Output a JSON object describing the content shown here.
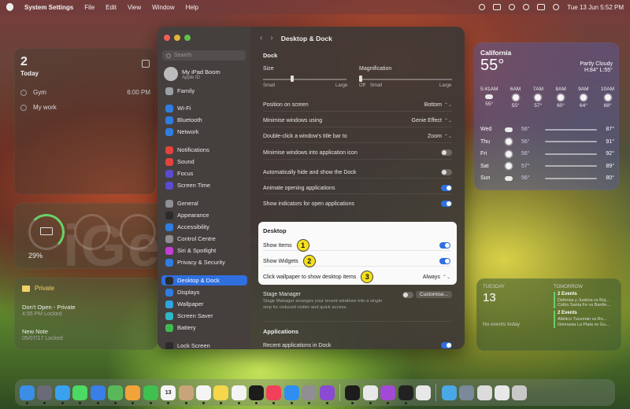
{
  "menubar": {
    "app_name": "System Settings",
    "menus": [
      "File",
      "Edit",
      "View",
      "Window",
      "Help"
    ],
    "clock": "Tue 13 Jun  5:52 PM"
  },
  "reminders_widget": {
    "count": "2",
    "label": "Today",
    "items": [
      {
        "title": "Gym",
        "time": "6:00 PM"
      },
      {
        "title": "My work",
        "time": ""
      }
    ]
  },
  "battery_widget": {
    "percent": "29%"
  },
  "notes_widget": {
    "folder": "Private",
    "notes": [
      {
        "title": "Don't Open - Private",
        "sub": "4:55 PM  Locked"
      },
      {
        "title": "New Note",
        "sub": "05/07/17  Locked"
      }
    ]
  },
  "weather_widget": {
    "city": "California",
    "temp": "55°",
    "condition": "Partly Cloudy",
    "hilo": "H:84° L:55°",
    "hours": [
      {
        "time": "5:41AM",
        "temp": "55°"
      },
      {
        "time": "6AM",
        "temp": "55°"
      },
      {
        "time": "7AM",
        "temp": "57°"
      },
      {
        "time": "8AM",
        "temp": "60°"
      },
      {
        "time": "9AM",
        "temp": "64°"
      },
      {
        "time": "10AM",
        "temp": "68°"
      }
    ],
    "days": [
      {
        "day": "Wed",
        "lo": "56°",
        "hi": "87°",
        "icon": "partly-cloudy-icon"
      },
      {
        "day": "Thu",
        "lo": "56°",
        "hi": "91°",
        "icon": "sun-icon"
      },
      {
        "day": "Fri",
        "lo": "56°",
        "hi": "92°",
        "icon": "sun-icon"
      },
      {
        "day": "Sat",
        "lo": "57°",
        "hi": "89°",
        "icon": "sun-icon"
      },
      {
        "day": "Sun",
        "lo": "56°",
        "hi": "80°",
        "icon": "cloud-icon"
      }
    ]
  },
  "calendar_widget": {
    "today_label": "TUESDAY",
    "today_num": "13",
    "no_events": "No events today",
    "tomorrow_label": "TOMORROW",
    "groups": [
      {
        "count": "2 Events",
        "lines": [
          "Defensa y Justicia vs Boj...",
          "Colón Santa Fe vs Banfie..."
        ]
      },
      {
        "count": "2 Events",
        "lines": [
          "Atlético Tucumán vs Ro...",
          "Gimnasia La Plata vs Gu..."
        ]
      }
    ]
  },
  "watermark": "iGeeksBlog",
  "sidebar": {
    "search_placeholder": "Search",
    "account_name": "My iPad Boom",
    "account_sub": "Apple ID",
    "items": [
      {
        "label": "Family",
        "color": "#9aa0a6"
      },
      {
        "label": "Wi-Fi",
        "color": "#2f7de0"
      },
      {
        "label": "Bluetooth",
        "color": "#2f7de0"
      },
      {
        "label": "Network",
        "color": "#2f7de0"
      },
      {
        "label": "Notifications",
        "color": "#e0443c"
      },
      {
        "label": "Sound",
        "color": "#e0443c"
      },
      {
        "label": "Focus",
        "color": "#5a4bd1"
      },
      {
        "label": "Screen Time",
        "color": "#5a4bd1"
      },
      {
        "label": "General",
        "color": "#8e8e93"
      },
      {
        "label": "Appearance",
        "color": "#2b2b2b"
      },
      {
        "label": "Accessibility",
        "color": "#2f7de0"
      },
      {
        "label": "Control Centre",
        "color": "#8e8e93"
      },
      {
        "label": "Siri & Spotlight",
        "color": "#c23fd6"
      },
      {
        "label": "Privacy & Security",
        "color": "#2f7de0"
      },
      {
        "label": "Desktop & Dock",
        "color": "#2b2b2b"
      },
      {
        "label": "Displays",
        "color": "#2f7de0"
      },
      {
        "label": "Wallpaper",
        "color": "#2fa4e0"
      },
      {
        "label": "Screen Saver",
        "color": "#2fb8c6"
      },
      {
        "label": "Battery",
        "color": "#3fb950"
      },
      {
        "label": "Lock Screen",
        "color": "#2b2b2b"
      }
    ]
  },
  "content": {
    "title": "Desktop & Dock",
    "dock_section": "Dock",
    "size_label": "Size",
    "size_min": "Small",
    "size_max": "Large",
    "size_value": 0.33,
    "mag_label": "Magnification",
    "mag_off": "Off",
    "mag_min": "Small",
    "mag_max": "Large",
    "mag_value": 0.0,
    "rows": [
      {
        "label": "Position on screen",
        "value": "Bottom",
        "type": "select"
      },
      {
        "label": "Minimise windows using",
        "value": "Genie Effect",
        "type": "select"
      },
      {
        "label": "Double-click a window's title bar to",
        "value": "Zoom",
        "type": "select"
      },
      {
        "label": "Minimise windows into application icon",
        "value": "",
        "type": "toggle",
        "on": false
      },
      {
        "label": "Automatically hide and show the Dock",
        "value": "",
        "type": "toggle",
        "on": false
      },
      {
        "label": "Animate opening applications",
        "value": "",
        "type": "toggle",
        "on": true
      },
      {
        "label": "Show indicators for open applications",
        "value": "",
        "type": "toggle",
        "on": true
      }
    ],
    "desktop_section": "Desktop",
    "desktop_rows": [
      {
        "label": "Show Items",
        "badge": "1",
        "type": "toggle",
        "on": true
      },
      {
        "label": "Show Widgets",
        "badge": "2",
        "type": "toggle",
        "on": true
      },
      {
        "label": "Click wallpaper to show desktop items",
        "badge": "3",
        "type": "select",
        "value": "Always"
      }
    ],
    "stage_label": "Stage Manager",
    "stage_desc": "Stage Manager arranges your recent windows into a single strip for reduced clutter and quick access.",
    "customise": "Customise...",
    "apps_section": "Applications",
    "recent_label": "Recent applications in Dock"
  },
  "dock": {
    "apps": [
      {
        "name": "finder",
        "color": "#3a8ee6",
        "label": ""
      },
      {
        "name": "launchpad",
        "color": "#6a6a78",
        "label": ""
      },
      {
        "name": "safari",
        "color": "#3aa0f0",
        "label": ""
      },
      {
        "name": "messages",
        "color": "#4cd964",
        "label": ""
      },
      {
        "name": "mail",
        "color": "#3a7fe6",
        "label": ""
      },
      {
        "name": "maps",
        "color": "#5ab85a",
        "label": ""
      },
      {
        "name": "photos",
        "color": "#f2a33a",
        "label": ""
      },
      {
        "name": "facetime",
        "color": "#3fc04f",
        "label": ""
      },
      {
        "name": "calendar",
        "color": "#f4f4f4",
        "label": "13"
      },
      {
        "name": "contacts",
        "color": "#c8a47a",
        "label": ""
      },
      {
        "name": "reminders",
        "color": "#f4f4f4",
        "label": ""
      },
      {
        "name": "notes",
        "color": "#f5d64c",
        "label": ""
      },
      {
        "name": "freeform",
        "color": "#f4f4f4",
        "label": ""
      },
      {
        "name": "tv",
        "color": "#1c1c1c",
        "label": ""
      },
      {
        "name": "music",
        "color": "#f2405a",
        "label": ""
      },
      {
        "name": "app-store",
        "color": "#2f8ef0",
        "label": ""
      },
      {
        "name": "system-settings",
        "color": "#8e8e93",
        "label": ""
      },
      {
        "name": "feedback",
        "color": "#8a4ad1",
        "label": ""
      },
      {
        "name": "stocks",
        "color": "#1c1c1c",
        "label": ""
      },
      {
        "name": "chrome",
        "color": "#e8e8e8",
        "label": ""
      },
      {
        "name": "podcasts",
        "color": "#a24ad6",
        "label": ""
      },
      {
        "name": "terminal",
        "color": "#222222",
        "label": ""
      },
      {
        "name": "chrome-2",
        "color": "#e8e8e8",
        "label": ""
      },
      {
        "name": "folder",
        "color": "#4aa8e6",
        "label": ""
      },
      {
        "name": "folder-2",
        "color": "#7a8a9a",
        "label": ""
      },
      {
        "name": "keyboard",
        "color": "#dcdcdc",
        "label": ""
      },
      {
        "name": "window",
        "color": "#e8e8e8",
        "label": ""
      },
      {
        "name": "trash",
        "color": "#c8c8c8",
        "label": ""
      }
    ]
  }
}
